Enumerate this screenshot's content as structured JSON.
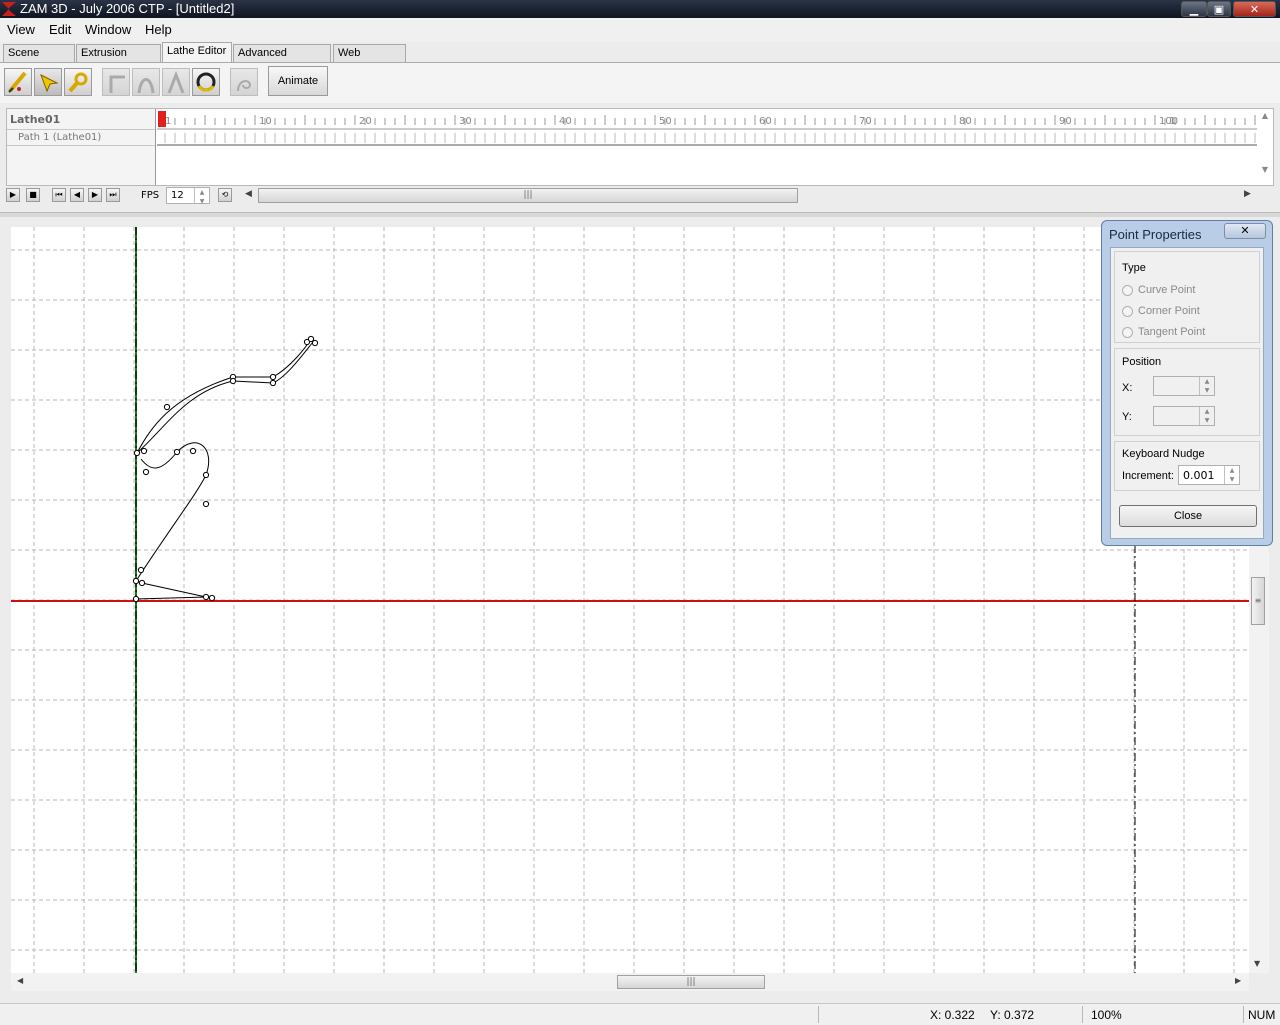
{
  "window": {
    "title": "ZAM 3D - July 2006 CTP - [Untitled2]",
    "minimize_glyph": "▁",
    "maximize_glyph": "▣",
    "close_glyph": "✕"
  },
  "menu": {
    "items": [
      "View",
      "Edit",
      "Window",
      "Help"
    ]
  },
  "tabs": [
    {
      "label": "Scene Editor",
      "active": false
    },
    {
      "label": "Extrusion Editor",
      "active": false
    },
    {
      "label": "Lathe Editor",
      "active": true
    },
    {
      "label": "Advanced Modeler",
      "active": false
    },
    {
      "label": "Web Assistant",
      "active": false
    }
  ],
  "toolbar": {
    "animate_label": "Animate"
  },
  "timeline": {
    "object_name": "Lathe01",
    "track_name": "Path 1 (Lathe01)",
    "ruler_labels": [
      "1",
      "10",
      "20",
      "30",
      "40",
      "50",
      "60",
      "70",
      "80",
      "90",
      "100",
      "1"
    ],
    "current_frame": "1"
  },
  "playback": {
    "fps_label": "FPS",
    "fps_value": "12"
  },
  "point_properties": {
    "title": "Point Properties",
    "type_group_label": "Type",
    "type_options": [
      "Curve Point",
      "Corner Point",
      "Tangent Point"
    ],
    "position_group_label": "Position",
    "x_label": "X:",
    "y_label": "Y:",
    "x_value": "",
    "y_value": "",
    "nudge_group_label": "Keyboard Nudge",
    "increment_label": "Increment:",
    "increment_value": "0.001",
    "close_label": "Close"
  },
  "status": {
    "x_coord": "X: 0.322",
    "y_coord": "Y: 0.372",
    "zoom": "100%",
    "num": "NUM"
  },
  "colors": {
    "axis_vertical": "#1a7a1a",
    "axis_horizontal": "#d01010",
    "grid": "#b8b8b8",
    "dialog_frame": "#b9cde6"
  }
}
